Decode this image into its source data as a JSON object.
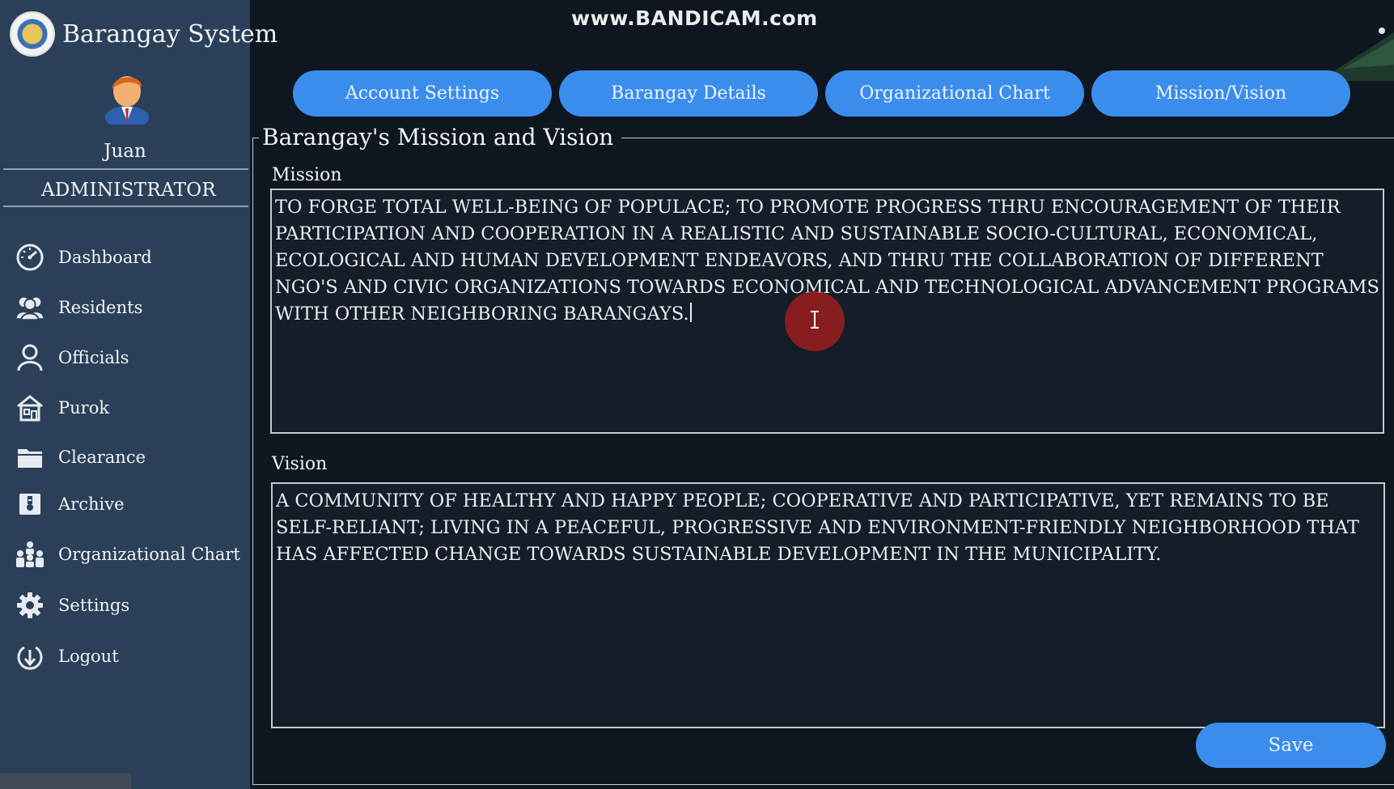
{
  "app": {
    "title": "Barangay System"
  },
  "user": {
    "name": "Juan",
    "role": "ADMINISTRATOR"
  },
  "sidebar": {
    "items": [
      {
        "label": "Dashboard",
        "icon": "dashboard-gauge-icon"
      },
      {
        "label": "Residents",
        "icon": "residents-group-icon"
      },
      {
        "label": "Officials",
        "icon": "official-person-icon"
      },
      {
        "label": "Purok",
        "icon": "purok-house-icon"
      },
      {
        "label": "Clearance",
        "icon": "folder-icon"
      },
      {
        "label": "Archive",
        "icon": "archive-icon"
      },
      {
        "label": "Organizational Chart",
        "icon": "org-chart-icon"
      },
      {
        "label": "Settings",
        "icon": "gear-icon"
      },
      {
        "label": "Logout",
        "icon": "logout-icon"
      }
    ]
  },
  "watermark": "www.BANDICAM.com",
  "tabs": [
    {
      "label": "Account Settings"
    },
    {
      "label": "Barangay Details"
    },
    {
      "label": "Organizational Chart"
    },
    {
      "label": "Mission/Vision"
    }
  ],
  "section": {
    "title": "Barangay's Mission and Vision",
    "mission_label": "Mission",
    "mission_text": "TO FORGE TOTAL WELL-BEING OF POPULACE; TO PROMOTE PROGRESS THRU ENCOURAGEMENT OF THEIR PARTICIPATION AND COOPERATION IN A REALISTIC AND SUSTAINABLE SOCIO-CULTURAL, ECONOMICAL, ECOLOGICAL AND HUMAN DEVELOPMENT ENDEAVORS, AND THRU THE COLLABORATION OF DIFFERENT NGO'S AND CIVIC ORGANIZATIONS TOWARDS ECONOMICAL AND TECHNOLOGICAL ADVANCEMENT PROGRAMS WITH OTHER NEIGHBORING BARANGAYS.",
    "vision_label": "Vision",
    "vision_text": "A COMMUNITY OF HEALTHY AND HAPPY PEOPLE; COOPERATIVE AND PARTICIPATIVE, YET REMAINS TO BE SELF-RELIANT; LIVING IN A PEACEFUL, PROGRESSIVE AND ENVIRONMENT-FRIENDLY NEIGHBORHOOD THAT HAS AFFECTED CHANGE TOWARDS SUSTAINABLE DEVELOPMENT IN THE MUNICIPALITY.",
    "save_label": "Save"
  },
  "colors": {
    "sidebar_bg": "#2b4058",
    "main_bg": "#0e1620",
    "accent": "#3b8ded",
    "cursor_highlight": "#af1e1e"
  }
}
